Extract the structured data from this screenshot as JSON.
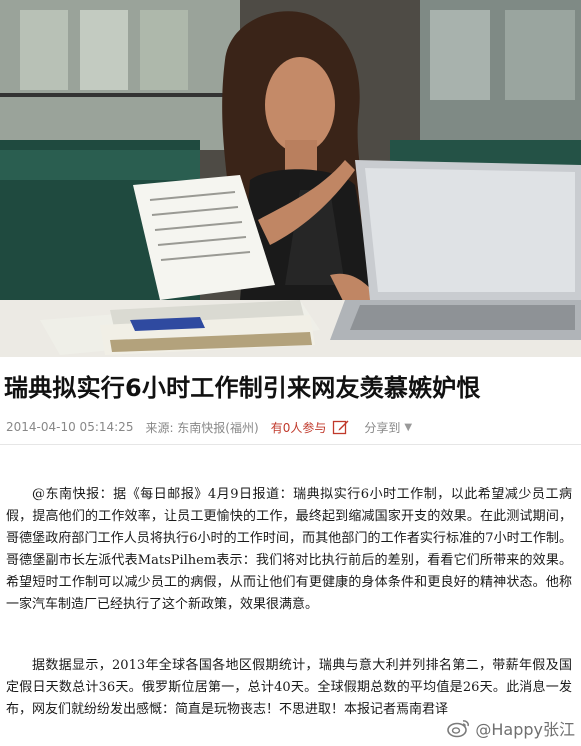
{
  "article": {
    "title": "瑞典拟实行6小时工作制引来网友羡慕嫉妒恨",
    "meta": {
      "date": "2014-04-10 05:14:25",
      "source": "来源: 东南快报(福州)",
      "participants": "有0人参与",
      "share": "分享到",
      "icons": [
        "edit-icon",
        "caret-down-icon"
      ]
    },
    "paragraphs": [
      "@东南快报：据《每日邮报》4月9日报道：瑞典拟实行6小时工作制，以此希望减少员工病假，提高他们的工作效率，让员工更愉快的工作，最终起到缩减国家开支的效果。在此测试期间，哥德堡政府部门工作人员将执行6小时的工作时间，而其他部门的工作者实行标准的7小时工作制。哥德堡副市长左派代表MatsPilhem表示：我们将对比执行前后的差别，看看它们所带来的效果。希望短时工作制可以减少员工的病假，从而让他们有更健康的身体条件和更良好的精神状态。他称一家汽车制造厂已经执行了这个新政策，效果很满意。",
      "据数据显示，2013年全球各国各地区假期统计，瑞典与意大利并列排名第二，带薪年假及国定假日天数总计36天。俄罗斯位居第一，总计40天。全球假期总数的平均值是26天。此消息一发布，网友们就纷纷发出感慨：简直是玩物丧志！不思进取！本报记者焉南君译"
    ]
  },
  "watermark": {
    "text": "@Happy张江",
    "icon": "weibo-icon"
  },
  "colors": {
    "title": "#111111",
    "meta": "#888888",
    "participants": "#c0392b"
  }
}
